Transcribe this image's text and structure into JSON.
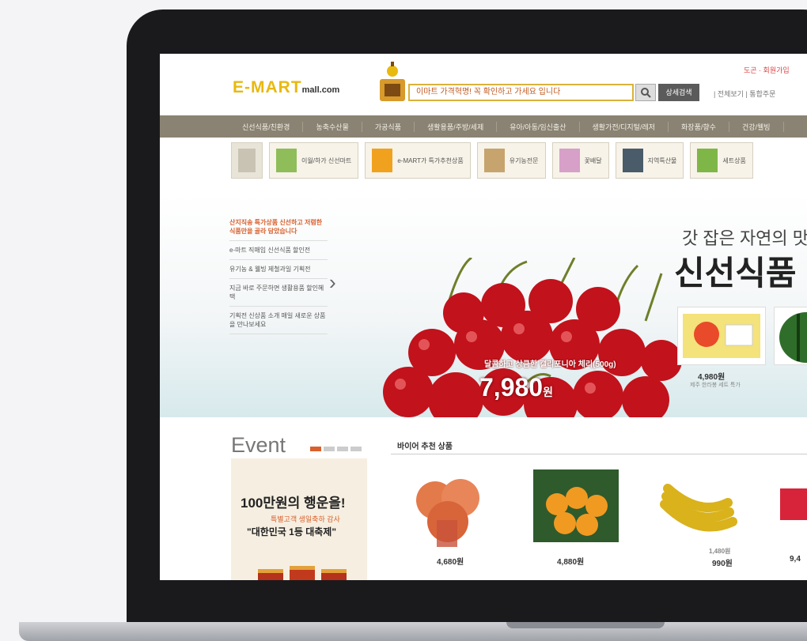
{
  "header": {
    "logo_main": "E-MART",
    "logo_suffix": "mall.com",
    "search_placeholder": "이마트 가격혁명! 꼭 확인하고 가세요 입니다",
    "detail_search_label": "상세검색",
    "util_links": "| 전체보기 | 통합주문",
    "top_promo": "도곤 · 회원가입"
  },
  "gnb": {
    "items": [
      "신선식품/친환경",
      "농축수산물",
      "가공식품",
      "생활용품/주방/세제",
      "유아/아동/임신출산",
      "생활가전/디지털/레저",
      "화장품/향수",
      "건강/웰빙"
    ]
  },
  "strip": {
    "tiles": [
      "이월/하가 신선마트",
      "e-MART가 특가추천상품",
      "유기농전문",
      "꽃배달",
      "지역특산물",
      "세트상품"
    ]
  },
  "hero": {
    "lnb": [
      {
        "text": "산지직송 특가상품 신선하고 저렴한 식품만을 골라 담았습니다",
        "red": true
      },
      {
        "text": "e-마트 직매입 신선식품 할인전",
        "red": false
      },
      {
        "text": "유기농 & 웰빙 제철과일 기획전",
        "red": false
      },
      {
        "text": "지금 바로 주문하면 생활용품 할인혜택",
        "red": false
      },
      {
        "text": "기획전 신상품 소개 매일 새로운 상품을 만나보세요",
        "red": false
      }
    ],
    "tagline": "달콤하고 상큼한 캘리포니아 체리(500g)",
    "price": "7,980",
    "price_unit": "원",
    "sub_title": "갓 잡은 자연의 맛",
    "main_title": "신선식품",
    "card1_price": "4,980원",
    "card1_desc": "제주 한라봉 세트 특가"
  },
  "event": {
    "title": "Event",
    "line1": "100만원의 행운을!",
    "line2": "특별고객 생일축하 감사",
    "line3": "\"대한민국 1등 대축제\""
  },
  "recommend": {
    "title": "바이어 추천 상품",
    "items": [
      {
        "name": "peaches",
        "price": "4,680원"
      },
      {
        "name": "tangerines",
        "price": "4,880원"
      },
      {
        "name": "bananas",
        "price": "990원",
        "old_price": "1,480원"
      },
      {
        "name": "strawberries",
        "price": "9,4"
      }
    ]
  },
  "colors": {
    "bezel": "#1a1a1c",
    "gnb_bg": "#8a8373",
    "accent": "#d8602c",
    "logo": "#e8b90f"
  }
}
